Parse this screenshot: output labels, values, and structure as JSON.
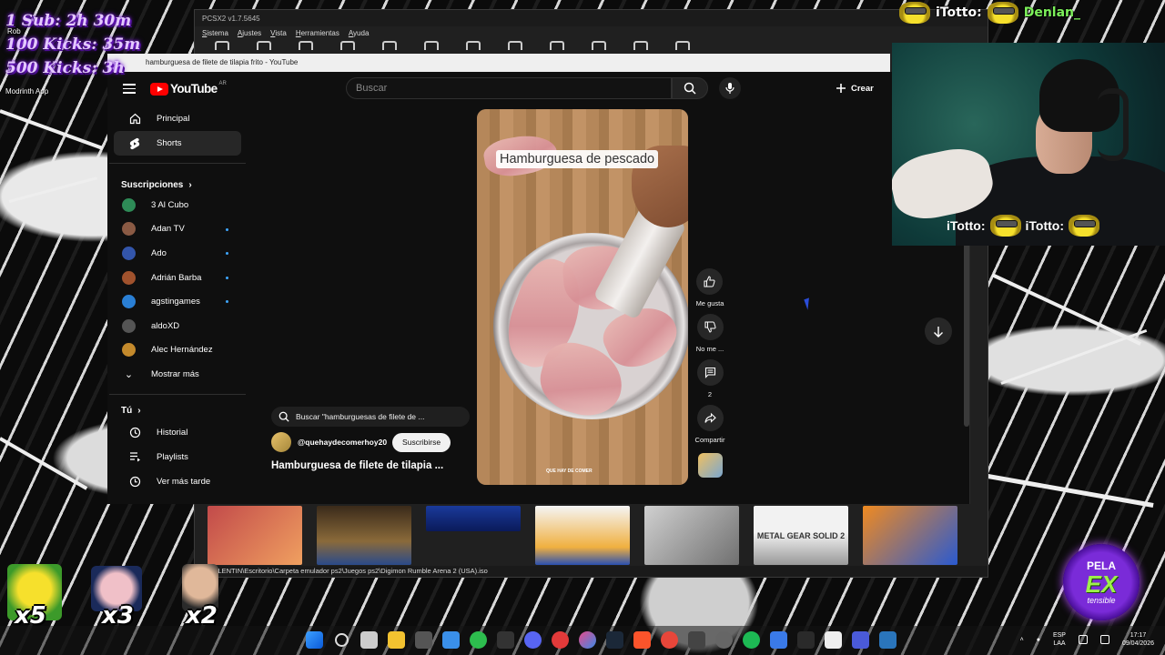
{
  "stream_overlay": {
    "goals": [
      "1 Sub: 2h 30m",
      "100 Kicks: 35m",
      "500 Kicks: 3h"
    ],
    "chat_top": [
      "iTotto:",
      "Denlan_"
    ],
    "chat_bottom": [
      "iTotto:",
      "iTotto:"
    ],
    "multipliers": [
      "x5",
      "x3",
      "x2"
    ],
    "brand": {
      "top": "PELA",
      "middle": "EX",
      "bottom": "tensible"
    }
  },
  "desktop": {
    "labels": [
      "Rob",
      "Modrinth App"
    ]
  },
  "pcsx2": {
    "title": "PCSX2 v1.7.5645",
    "menu": [
      "Sistema",
      "Ajustes",
      "Vista",
      "Herramientas",
      "Ayuda"
    ],
    "covers": [
      "",
      "",
      "",
      "",
      "",
      "METAL GEAR SOLID 2",
      ""
    ],
    "status_path": "VALENTIN\\Escritorio\\Carpeta emulador ps2\\Juegos ps2\\Digimon Rumble Arena 2 (USA).iso"
  },
  "browser": {
    "tab_title": "hamburguesa de filete de tilapia frito",
    "tab_suffix": "- YouTube"
  },
  "youtube": {
    "logo": "YouTube",
    "country": "AR",
    "search_placeholder": "Buscar",
    "create_label": "Crear",
    "nav": [
      {
        "label": "Principal",
        "icon": "home-icon"
      },
      {
        "label": "Shorts",
        "icon": "shorts-icon",
        "active": true
      }
    ],
    "subscriptions_heading": "Suscripciones",
    "subscriptions": [
      {
        "name": "3 Al Cubo",
        "color": "#2e8b57",
        "dot": false
      },
      {
        "name": "Adan TV",
        "color": "#8a5a44",
        "dot": true
      },
      {
        "name": "Ado",
        "color": "#3355aa",
        "dot": true
      },
      {
        "name": "Adrián Barba",
        "color": "#a0522d",
        "dot": true
      },
      {
        "name": "agstingames",
        "color": "#2a7fd4",
        "dot": true
      },
      {
        "name": "aldoXD",
        "color": "#555555",
        "dot": false
      },
      {
        "name": "Alec Hernández",
        "color": "#c48a2c",
        "dot": false
      }
    ],
    "show_more": "Mostrar más",
    "you_heading": "Tú",
    "you_items": [
      {
        "label": "Historial",
        "icon": "history-icon"
      },
      {
        "label": "Playlists",
        "icon": "playlists-icon"
      },
      {
        "label": "Ver más tarde",
        "icon": "watch-later-icon"
      }
    ],
    "short": {
      "caption": "Hamburguesa de pescado",
      "watermark": "QUE HAY DE COMER",
      "search_text": "Buscar \"hamburguesas de filete de ...",
      "channel": "@quehaydecomerhoy20",
      "subscribe": "Suscribirse",
      "title": "Hamburguesa de filete de tilapia ...",
      "actions": [
        {
          "label": "Me gusta",
          "icon": "thumbs-up-icon"
        },
        {
          "label": "No me ...",
          "icon": "thumbs-down-icon"
        },
        {
          "label": "2",
          "icon": "comment-icon"
        },
        {
          "label": "Compartir",
          "icon": "share-icon"
        }
      ]
    }
  },
  "taskbar": {
    "lang": [
      "ESP",
      "LAA"
    ],
    "time": "17:17",
    "date": "09/04/2026"
  }
}
